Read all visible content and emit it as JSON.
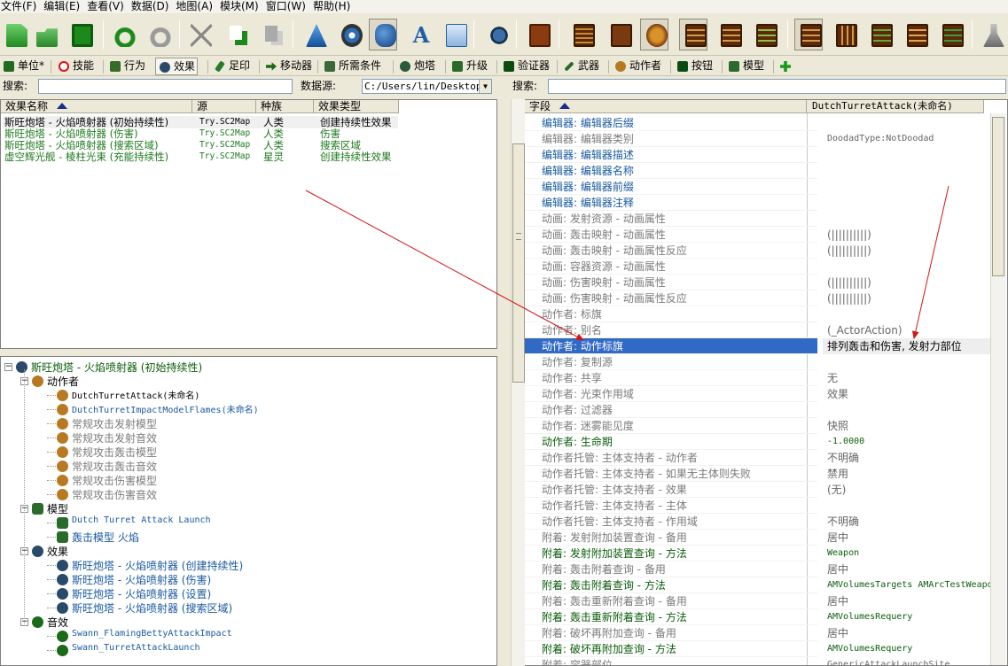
{
  "menu": [
    "文件(F)",
    "编辑(E)",
    "查看(V)",
    "数据(D)",
    "地图(A)",
    "模块(M)",
    "窗口(W)",
    "帮助(H)"
  ],
  "tabs": [
    {
      "label": "单位*",
      "icon": "unit-icon"
    },
    {
      "label": "技能",
      "icon": "ability-icon"
    },
    {
      "label": "行为",
      "icon": "behavior-icon"
    },
    {
      "label": "效果",
      "icon": "effect-icon"
    },
    {
      "label": "足印",
      "icon": "footprint-icon"
    },
    {
      "label": "移动器",
      "icon": "mover-icon"
    },
    {
      "label": "所需条件",
      "icon": "requirement-icon"
    },
    {
      "label": "炮塔",
      "icon": "turret-icon"
    },
    {
      "label": "升级",
      "icon": "upgrade-icon"
    },
    {
      "label": "验证器",
      "icon": "validator-icon"
    },
    {
      "label": "武器",
      "icon": "weapon-icon"
    },
    {
      "label": "动作者",
      "icon": "actor-icon"
    },
    {
      "label": "按钮",
      "icon": "button-icon"
    },
    {
      "label": "模型",
      "icon": "model-icon"
    },
    {
      "label": "",
      "icon": "add-tab-icon"
    }
  ],
  "left_search": {
    "label": "搜索:",
    "value": ""
  },
  "datasource": {
    "label": "数据源:",
    "value": "C:/Users/lin/Desktop/"
  },
  "right_search": {
    "label": "搜索:",
    "value": ""
  },
  "effect_list": {
    "headers": [
      "效果名称",
      "源",
      "种族",
      "效果类型"
    ],
    "rows": [
      {
        "name": "斯旺炮塔 - 火焰喷射器 (初始持续性)",
        "source": "Try.SC2Map",
        "race": "人类",
        "type": "创建持续性效果",
        "selected": true
      },
      {
        "name": "斯旺炮塔 - 火焰喷射器 (伤害)",
        "source": "Try.SC2Map",
        "race": "人类",
        "type": "伤害",
        "selected": false
      },
      {
        "name": "斯旺炮塔 - 火焰喷射器 (搜索区域)",
        "source": "Try.SC2Map",
        "race": "人类",
        "type": "搜索区域",
        "selected": false
      },
      {
        "name": "虚空辉光舰 - 棱柱光束 (充能持续性)",
        "source": "Try.SC2Map",
        "race": "星灵",
        "type": "创建持续性效果",
        "selected": false
      }
    ]
  },
  "tree": {
    "root": "斯旺炮塔 - 火焰喷射器 (初始持续性)",
    "groups": [
      {
        "label": "动作者",
        "items": [
          {
            "text": "DutchTurretAttack(未命名)",
            "style": "black"
          },
          {
            "text": "DutchTurretImpactModelFlames(未命名)",
            "style": "blue"
          },
          {
            "text": "常规攻击发射模型",
            "style": "gray"
          },
          {
            "text": "常规攻击发射音效",
            "style": "gray"
          },
          {
            "text": "常规攻击轰击模型",
            "style": "gray"
          },
          {
            "text": "常规攻击轰击音效",
            "style": "gray"
          },
          {
            "text": "常规攻击伤害模型",
            "style": "gray"
          },
          {
            "text": "常规攻击伤害音效",
            "style": "gray"
          }
        ]
      },
      {
        "label": "模型",
        "items": [
          {
            "text": "Dutch Turret Attack Launch",
            "style": "blue"
          },
          {
            "text": "轰击模型 火焰",
            "style": "blue"
          }
        ]
      },
      {
        "label": "效果",
        "items": [
          {
            "text": "斯旺炮塔 - 火焰喷射器 (创建持续性)",
            "style": "blue"
          },
          {
            "text": "斯旺炮塔 - 火焰喷射器 (伤害)",
            "style": "blue"
          },
          {
            "text": "斯旺炮塔 - 火焰喷射器 (设置)",
            "style": "blue"
          },
          {
            "text": "斯旺炮塔 - 火焰喷射器 (搜索区域)",
            "style": "blue"
          }
        ]
      },
      {
        "label": "音效",
        "items": [
          {
            "text": "Swann_FlamingBettyAttackImpact",
            "style": "blue"
          },
          {
            "text": "Swann_TurretAttackLaunch",
            "style": "blue"
          }
        ]
      }
    ]
  },
  "props": {
    "headers": [
      "字段",
      "DutchTurretAttack(未命名)"
    ],
    "rows": [
      {
        "field": "编辑器: 编辑器后缀",
        "value": "",
        "style": "blue"
      },
      {
        "field": "编辑器: 编辑器类别",
        "value": "DoodadType:NotDoodad",
        "style": "gray"
      },
      {
        "field": "编辑器: 编辑器描述",
        "value": "",
        "style": "blue"
      },
      {
        "field": "编辑器: 编辑器名称",
        "value": "",
        "style": "blue"
      },
      {
        "field": "编辑器: 编辑器前缀",
        "value": "",
        "style": "blue"
      },
      {
        "field": "编辑器: 编辑器注释",
        "value": "",
        "style": "blue"
      },
      {
        "field": "动画: 发射资源 - 动画属性",
        "value": "",
        "style": "gray"
      },
      {
        "field": "动画: 轰击映射 - 动画属性",
        "value": "(||||||||||)",
        "style": "gray"
      },
      {
        "field": "动画: 轰击映射 - 动画属性反应",
        "value": "(||||||||||)",
        "style": "gray"
      },
      {
        "field": "动画: 容器资源 - 动画属性",
        "value": "",
        "style": "gray"
      },
      {
        "field": "动画: 伤害映射 - 动画属性",
        "value": "(||||||||||)",
        "style": "gray"
      },
      {
        "field": "动画: 伤害映射 - 动画属性反应",
        "value": "(||||||||||)",
        "style": "gray"
      },
      {
        "field": "动作者: 标旗",
        "value": "",
        "style": "gray"
      },
      {
        "field": "动作者: 别名",
        "value": "(_ActorAction)",
        "style": "gray"
      },
      {
        "field": "动作者: 动作标旗",
        "value": "排列轰击和伤害, 发射力部位",
        "style": "selected"
      },
      {
        "field": "动作者: 复制源",
        "value": "",
        "style": "gray"
      },
      {
        "field": "动作者: 共享",
        "value": "无",
        "style": "gray"
      },
      {
        "field": "动作者: 光束作用域",
        "value": "效果",
        "style": "gray"
      },
      {
        "field": "动作者: 过滤器",
        "value": "",
        "style": "gray"
      },
      {
        "field": "动作者: 迷雾能见度",
        "value": "快照",
        "style": "gray"
      },
      {
        "field": "动作者: 生命期",
        "value": "-1.0000",
        "style": "green"
      },
      {
        "field": "动作者托管: 主体支持者 - 动作者",
        "value": "不明确",
        "style": "gray"
      },
      {
        "field": "动作者托管: 主体支持者 - 如果无主体则失败",
        "value": "禁用",
        "style": "gray"
      },
      {
        "field": "动作者托管: 主体支持者 - 效果",
        "value": "(无)",
        "style": "gray"
      },
      {
        "field": "动作者托管: 主体支持者 - 主体",
        "value": "",
        "style": "gray"
      },
      {
        "field": "动作者托管: 主体支持者 - 作用域",
        "value": "不明确",
        "style": "gray"
      },
      {
        "field": "附着: 发射附加装置查询 - 备用",
        "value": "居中",
        "style": "gray"
      },
      {
        "field": "附着: 发射附加装置查询 - 方法",
        "value": "Weapon",
        "style": "green"
      },
      {
        "field": "附着: 轰击附着查询 - 备用",
        "value": "居中",
        "style": "gray"
      },
      {
        "field": "附着: 轰击附着查询 - 方法",
        "value": "AMVolumesTargets AMArcTestWeapon",
        "style": "green"
      },
      {
        "field": "附着: 轰击重新附着查询 - 备用",
        "value": "居中",
        "style": "gray"
      },
      {
        "field": "附着: 轰击重新附着查询 - 方法",
        "value": "AMVolumesRequery",
        "style": "green"
      },
      {
        "field": "附着: 破坏再附加查询 - 备用",
        "value": "居中",
        "style": "gray"
      },
      {
        "field": "附着: 破坏再附加查询 - 方法",
        "value": "AMVolumesRequery",
        "style": "green"
      },
      {
        "field": "附着: 容器部位",
        "value": "GenericAttackLaunchSite",
        "style": "gray"
      }
    ]
  },
  "colors": {
    "blue": "#1a5aa0",
    "gray": "#7b7b7b",
    "green": "#0b5d0b",
    "selected_bg": "#316ac5",
    "annotation": "#d21515",
    "list_green": "#1c7a1c"
  }
}
